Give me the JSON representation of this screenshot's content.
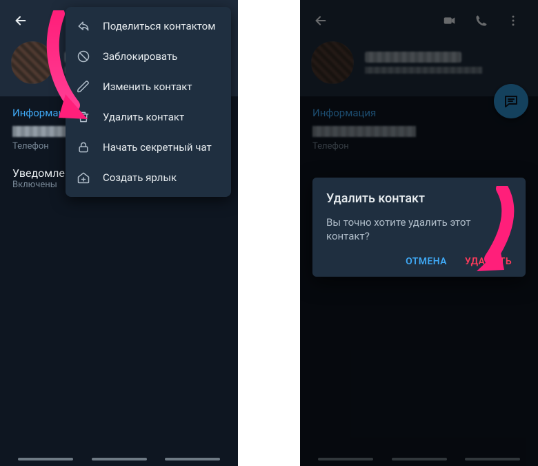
{
  "left": {
    "section_info_title": "Информация",
    "phone_sub": "Телефон",
    "notif_title": "Уведомления",
    "notif_sub": "Включены",
    "menu": {
      "share": "Поделиться контактом",
      "block": "Заблокировать",
      "edit": "Изменить контакт",
      "delete": "Удалить контакт",
      "secret": "Начать секретный чат",
      "shortcut": "Создать ярлык"
    }
  },
  "right": {
    "section_info_title": "Информация",
    "phone_sub": "Телефон",
    "dialog": {
      "title": "Удалить контакт",
      "body": "Вы точно хотите удалить этот контакт?",
      "cancel": "ОТМЕНА",
      "delete": "УДАЛИТЬ"
    }
  },
  "colors": {
    "accent": "#3fa9f5",
    "danger": "#ff3b5c",
    "arrow": "#ff1f7a"
  }
}
